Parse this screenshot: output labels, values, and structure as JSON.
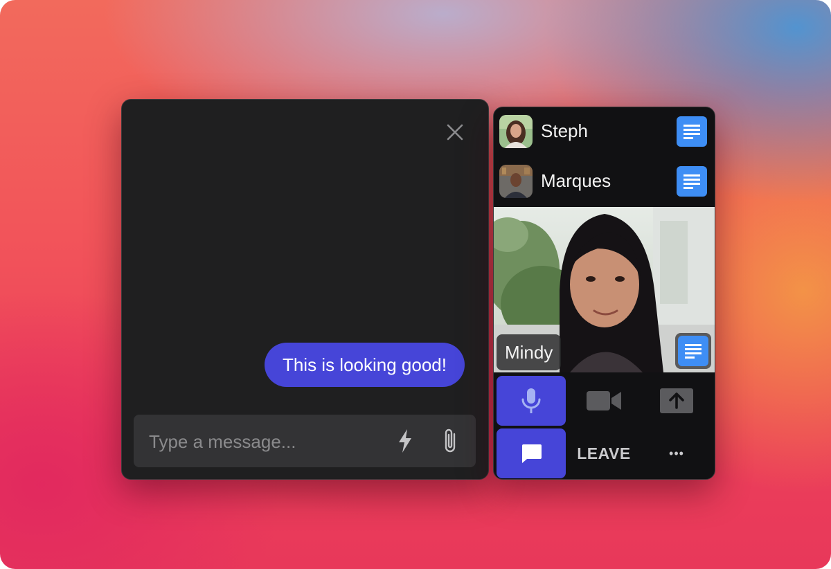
{
  "chat": {
    "message": "This is looking good!",
    "composer_placeholder": "Type a message..."
  },
  "participants": [
    {
      "name": "Steph"
    },
    {
      "name": "Marques"
    }
  ],
  "active_speaker": {
    "name": "Mindy"
  },
  "controls": {
    "leave_label": "LEAVE",
    "more_label": "•••"
  },
  "colors": {
    "accent": "#4645d8",
    "notes_blue": "#3e8ef5",
    "panel_bg": "#1f1f20",
    "call_bg": "#111113"
  }
}
